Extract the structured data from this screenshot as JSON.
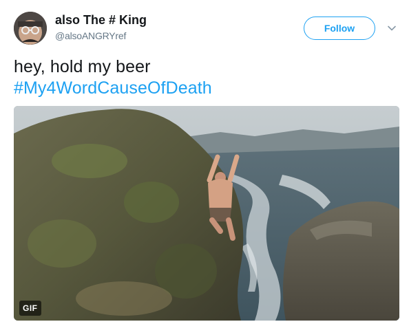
{
  "user": {
    "display_name": "also The # King",
    "handle": "@alsoANGRYref"
  },
  "follow_button": {
    "label": "Follow"
  },
  "tweet": {
    "text_line1": "hey, hold my beer",
    "hashtag": "#My4WordCauseOfDeath"
  },
  "media": {
    "badge": "GIF"
  },
  "colors": {
    "brand_blue": "#1da1f2",
    "text_primary": "#14171a",
    "text_secondary": "#657786"
  },
  "icons": {
    "more_menu": "chevron-down-icon"
  }
}
